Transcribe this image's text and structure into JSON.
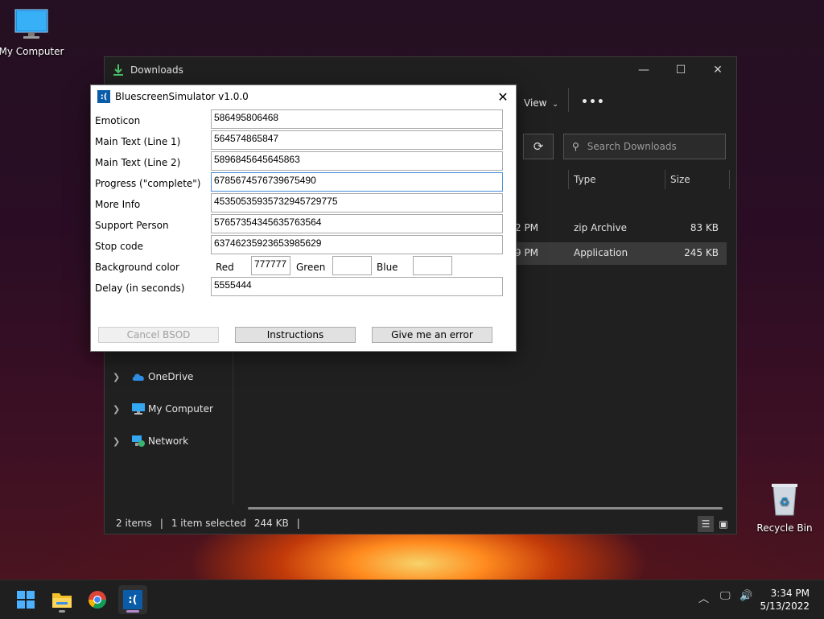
{
  "desktop": {
    "my_computer_label": "My Computer",
    "recycle_bin_label": "Recycle Bin"
  },
  "explorer": {
    "title": "Downloads",
    "view_label": "View",
    "more_label": "•••",
    "search_placeholder": "Search Downloads",
    "columns": [
      "Type",
      "Size"
    ],
    "rows": [
      {
        "date_fragment": "2 PM",
        "type": "zip Archive",
        "size": "83 KB"
      },
      {
        "date_fragment": "9 PM",
        "type": "Application",
        "size": "245 KB"
      }
    ],
    "sidebar": [
      {
        "label": "OneDrive",
        "icon": "cloud-icon"
      },
      {
        "label": "My Computer",
        "icon": "monitor-icon"
      },
      {
        "label": "Network",
        "icon": "network-icon"
      }
    ],
    "status": {
      "items": "2 items",
      "selected": "1 item selected",
      "size": "244 KB",
      "sep": "|"
    }
  },
  "dialog": {
    "title": "BluescreenSimulator v1.0.0",
    "icon_glyph": ":(",
    "fields": [
      {
        "label": "Emoticon",
        "value": "586495806468"
      },
      {
        "label": "Main Text (Line 1)",
        "value": "564574865847"
      },
      {
        "label": "Main Text (Line 2)",
        "value": "5896845645645863"
      },
      {
        "label": "Progress (\"complete\")",
        "value": "6785674576739675490"
      },
      {
        "label": "More Info",
        "value": "45350535935732945729775"
      },
      {
        "label": "Support Person",
        "value": "57657354345635763564"
      },
      {
        "label": "Stop code",
        "value": "63746235923653985629"
      }
    ],
    "background": {
      "label": "Background color",
      "red_label": "Red",
      "red_value": "777777",
      "green_label": "Green",
      "green_value": "",
      "blue_label": "Blue",
      "blue_value": ""
    },
    "delay": {
      "label": "Delay (in seconds)",
      "value": "5555444"
    },
    "buttons": {
      "cancel": "Cancel BSOD",
      "instructions": "Instructions",
      "error": "Give me an error"
    }
  },
  "taskbar": {
    "time": "3:34 PM",
    "date": "5/13/2022"
  }
}
